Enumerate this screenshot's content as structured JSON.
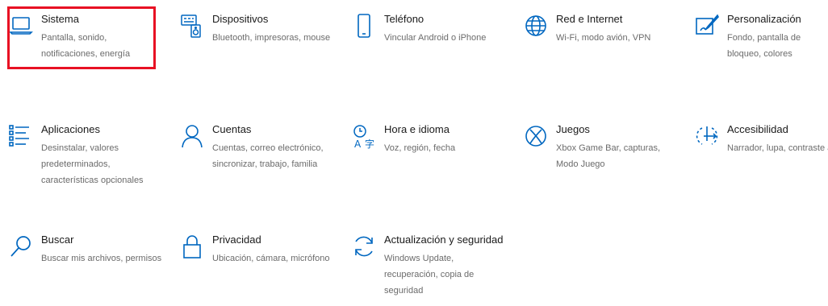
{
  "accent_color": "#0067c0",
  "highlight_color": "#e81123",
  "settings": [
    {
      "title": "Sistema",
      "desc": "Pantalla, sonido, notificaciones, energía",
      "icon": "laptop-icon"
    },
    {
      "title": "Dispositivos",
      "desc": "Bluetooth, impresoras, mouse",
      "icon": "devices-icon"
    },
    {
      "title": "Teléfono",
      "desc": "Vincular Android o iPhone",
      "icon": "phone-icon"
    },
    {
      "title": "Red e Internet",
      "desc": "Wi-Fi, modo avión, VPN",
      "icon": "globe-icon"
    },
    {
      "title": "Personalización",
      "desc": "Fondo, pantalla de bloqueo, colores",
      "icon": "personalization-icon"
    },
    {
      "title": "Aplicaciones",
      "desc": "Desinstalar, valores predeterminados, características opcionales",
      "icon": "apps-list-icon"
    },
    {
      "title": "Cuentas",
      "desc": "Cuentas, correo electrónico, sincronizar, trabajo, familia",
      "icon": "person-icon"
    },
    {
      "title": "Hora e idioma",
      "desc": "Voz, región, fecha",
      "icon": "time-language-icon"
    },
    {
      "title": "Juegos",
      "desc": "Xbox Game Bar, capturas, Modo Juego",
      "icon": "xbox-icon"
    },
    {
      "title": "Accesibilidad",
      "desc": "Narrador, lupa, contraste alto",
      "icon": "accessibility-icon"
    },
    {
      "title": "Buscar",
      "desc": "Buscar mis archivos, permisos",
      "icon": "search-icon"
    },
    {
      "title": "Privacidad",
      "desc": "Ubicación, cámara, micrófono",
      "icon": "lock-icon"
    },
    {
      "title": "Actualización y seguridad",
      "desc": "Windows Update, recuperación, copia de seguridad",
      "icon": "refresh-icon"
    }
  ]
}
